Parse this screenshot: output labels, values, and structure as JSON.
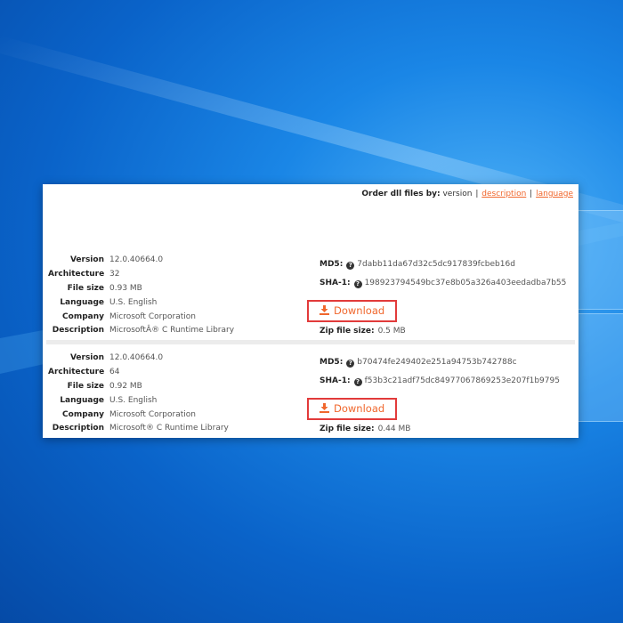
{
  "order": {
    "label": "Order dll files by:",
    "version": "version",
    "separator": "|",
    "description": "description",
    "language": "language"
  },
  "labels": {
    "version": "Version",
    "architecture": "Architecture",
    "file_size": "File size",
    "language": "Language",
    "company": "Company",
    "description": "Description",
    "md5": "MD5:",
    "sha1": "SHA-1:",
    "zip_size": "Zip file size:",
    "download": "Download"
  },
  "files": [
    {
      "version": "12.0.40664.0",
      "architecture": "32",
      "file_size": "0.93 MB",
      "language": "U.S. English",
      "company": "Microsoft Corporation",
      "description": "MicrosoftÂ® C Runtime Library",
      "md5": "7dabb11da67d32c5dc917839fcbeb16d",
      "sha1": "198923794549bc37e8b05a326a403eedadba7b55",
      "zip_size": "0.5 MB"
    },
    {
      "version": "12.0.40664.0",
      "architecture": "64",
      "file_size": "0.92 MB",
      "language": "U.S. English",
      "company": "Microsoft Corporation",
      "description": "Microsoft® C Runtime Library",
      "md5": "b70474fe249402e251a94753b742788c",
      "sha1": "f53b3c21adf75dc84977067869253e207f1b9795",
      "zip_size": "0.44 MB"
    }
  ],
  "colors": {
    "accent": "#f0672d",
    "download_border": "#e23b3b",
    "desktop": "#0a63c9"
  }
}
